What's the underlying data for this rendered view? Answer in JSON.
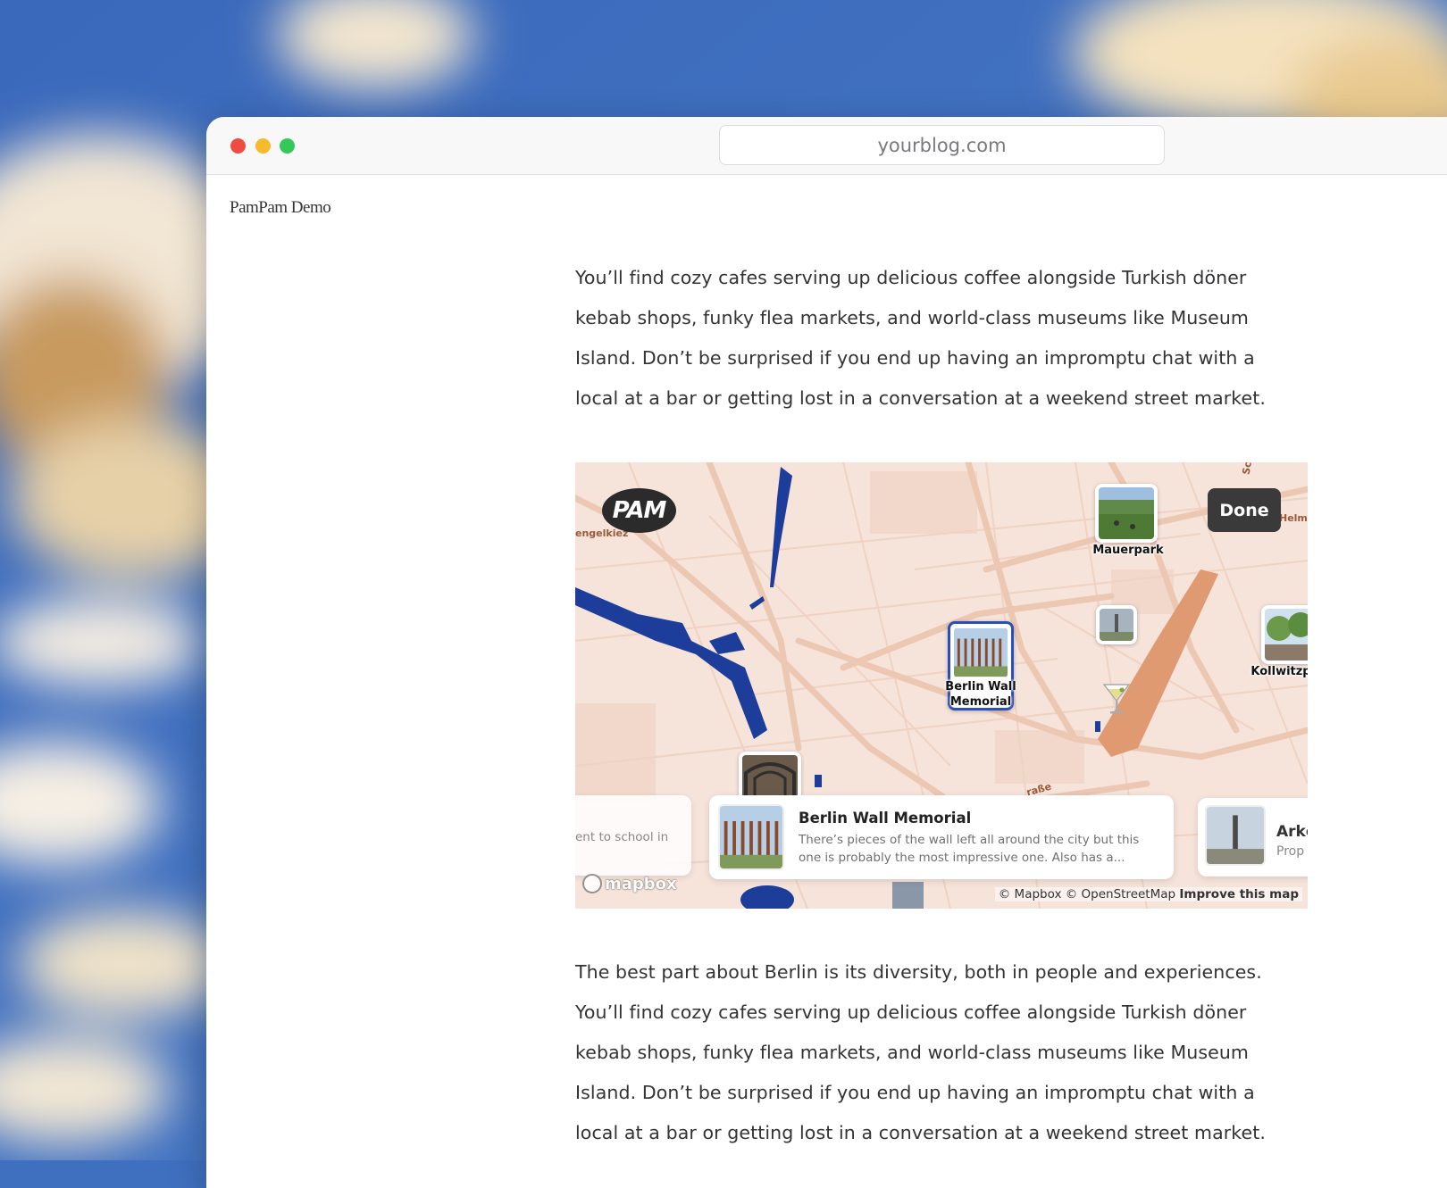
{
  "browser": {
    "url": "yourblog.com"
  },
  "site": {
    "name": "PamPam Demo"
  },
  "article": {
    "paragraph_1": "You’ll find cozy cafes serving up delicious coffee alongside Turkish döner kebab shops, funky flea markets, and world-class museums like Museum Island. Don’t be surprised if you end up having an impromptu chat with a local at a bar or getting lost in a conversation at a weekend street market.",
    "paragraph_2": "The best part about Berlin is its diversity, both in people and experiences. You’ll find cozy cafes serving up delicious coffee alongside Turkish döner kebab shops, funky flea markets, and world-class museums like Museum Island. Don’t be surprised if you end up having an impromptu chat with a local at a bar or getting lost in a conversation at a weekend street market."
  },
  "map": {
    "logo": "PAM",
    "done_label": "Done",
    "street_labels": {
      "left": "engelkiez",
      "right": "Helm",
      "top": "Sc",
      "bottom": "raße"
    },
    "pins": {
      "mauerpark": "Mauerpark",
      "berlin_wall_line1": "Berlin Wall",
      "berlin_wall_line2": "Memorial",
      "kollwitz": "Kollwitzp"
    },
    "cards": {
      "left_partial": "ent to school in",
      "selected_title": "Berlin Wall Memorial",
      "selected_desc": "There’s pieces of the wall left all around the city but this one is probably the most impressive one. Also has a...",
      "right_title": "Arkc",
      "right_sub": "Prop"
    },
    "mapbox_logo": "mapbox",
    "attribution_text": "© Mapbox © OpenStreetMap",
    "improve_link": "Improve this map",
    "colors": {
      "land": "#f6e3da",
      "road": "#ecc7b2",
      "water": "#1d3d9a",
      "park": "#e09a72",
      "selected": "#2a4fb8"
    }
  }
}
